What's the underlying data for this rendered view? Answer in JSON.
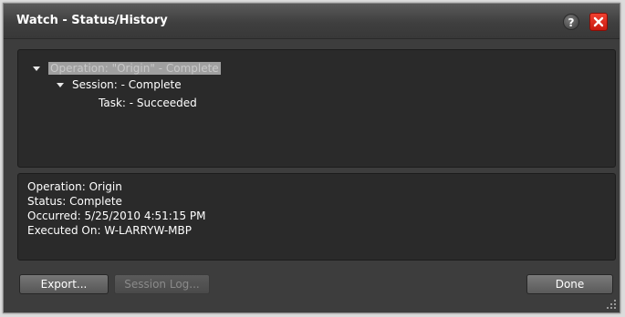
{
  "window": {
    "title": "Watch - Status/History",
    "help_label": "?"
  },
  "tree": {
    "operation": "Operation: \"Origin\" - Complete",
    "session": "Session:  - Complete",
    "task": "Task:  - Succeeded"
  },
  "details": {
    "operation": "Operation: Origin",
    "status": "Status: Complete",
    "occurred": "Occurred: 5/25/2010 4:51:15 PM",
    "executed_on": "Executed On: W-LARRYW-MBP"
  },
  "buttons": {
    "export": "Export...",
    "session_log": "Session Log...",
    "done": "Done"
  },
  "colors": {
    "panel_bg": "#2a2a2a",
    "window_bg": "#3d3d3d",
    "close_red": "#e02a1c",
    "selection": "#a0a0a0"
  }
}
